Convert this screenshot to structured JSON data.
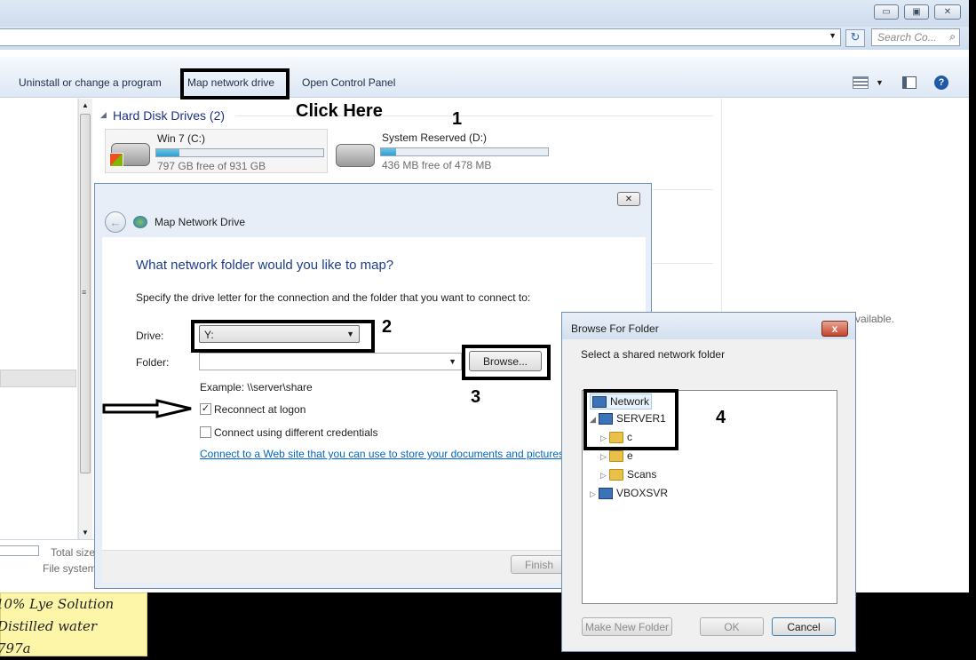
{
  "window": {
    "minimize_glyph": "▭",
    "maximize_glyph": "▣",
    "close_glyph": "✕"
  },
  "address_bar": {
    "search_placeholder": "Search Co...",
    "search_icon": "search-icon",
    "refresh_icon": "refresh-icon"
  },
  "command_bar": {
    "uninstall_label": "Uninstall or change a program",
    "map_drive_label": "Map network drive",
    "control_panel_label": "Open Control Panel"
  },
  "content": {
    "group_label": "Hard Disk Drives (2)",
    "drives": [
      {
        "name": "Win 7 (C:)",
        "free_text": "797 GB free of 931 GB",
        "used_fraction": 0.14
      },
      {
        "name": "System Reserved (D:)",
        "free_text": "436 MB free of 478 MB",
        "used_fraction": 0.09
      }
    ],
    "right_partial_text": "vailable."
  },
  "details_pane": {
    "total_size_label": "Total size",
    "file_system_label": "File system"
  },
  "annotations": {
    "click_here": "Click Here",
    "step1": "1",
    "step2": "2",
    "step3": "3",
    "step4": "4"
  },
  "map_dialog": {
    "title": "Map Network Drive",
    "heading": "What network folder would you like to map?",
    "instruction": "Specify the drive letter for the connection and the folder that you want to connect to:",
    "drive_label": "Drive:",
    "drive_value": "Y:",
    "folder_label": "Folder:",
    "folder_value": "",
    "browse_label": "Browse...",
    "example": "Example: \\\\server\\share",
    "reconnect_label": "Reconnect at logon",
    "reconnect_checked": true,
    "credentials_label": "Connect using different credentials",
    "credentials_checked": false,
    "link_text": "Connect to a Web site that you can use to store your documents and pictures",
    "finish_label": "Finish",
    "close_glyph": "✕"
  },
  "browse_dialog": {
    "title": "Browse For Folder",
    "instruction": "Select a shared network folder",
    "tree": {
      "network": "Network",
      "server1": "SERVER1",
      "share_c": "c",
      "share_e": "e",
      "share_scans": "Scans",
      "vboxsvr": "VBOXSVR"
    },
    "make_folder_label": "Make New Folder",
    "ok_label": "OK",
    "cancel_label": "Cancel",
    "close_glyph": "x"
  },
  "sticky_note": {
    "lines": [
      "10% Lye Solution",
      "Distilled water",
      "797a"
    ]
  }
}
